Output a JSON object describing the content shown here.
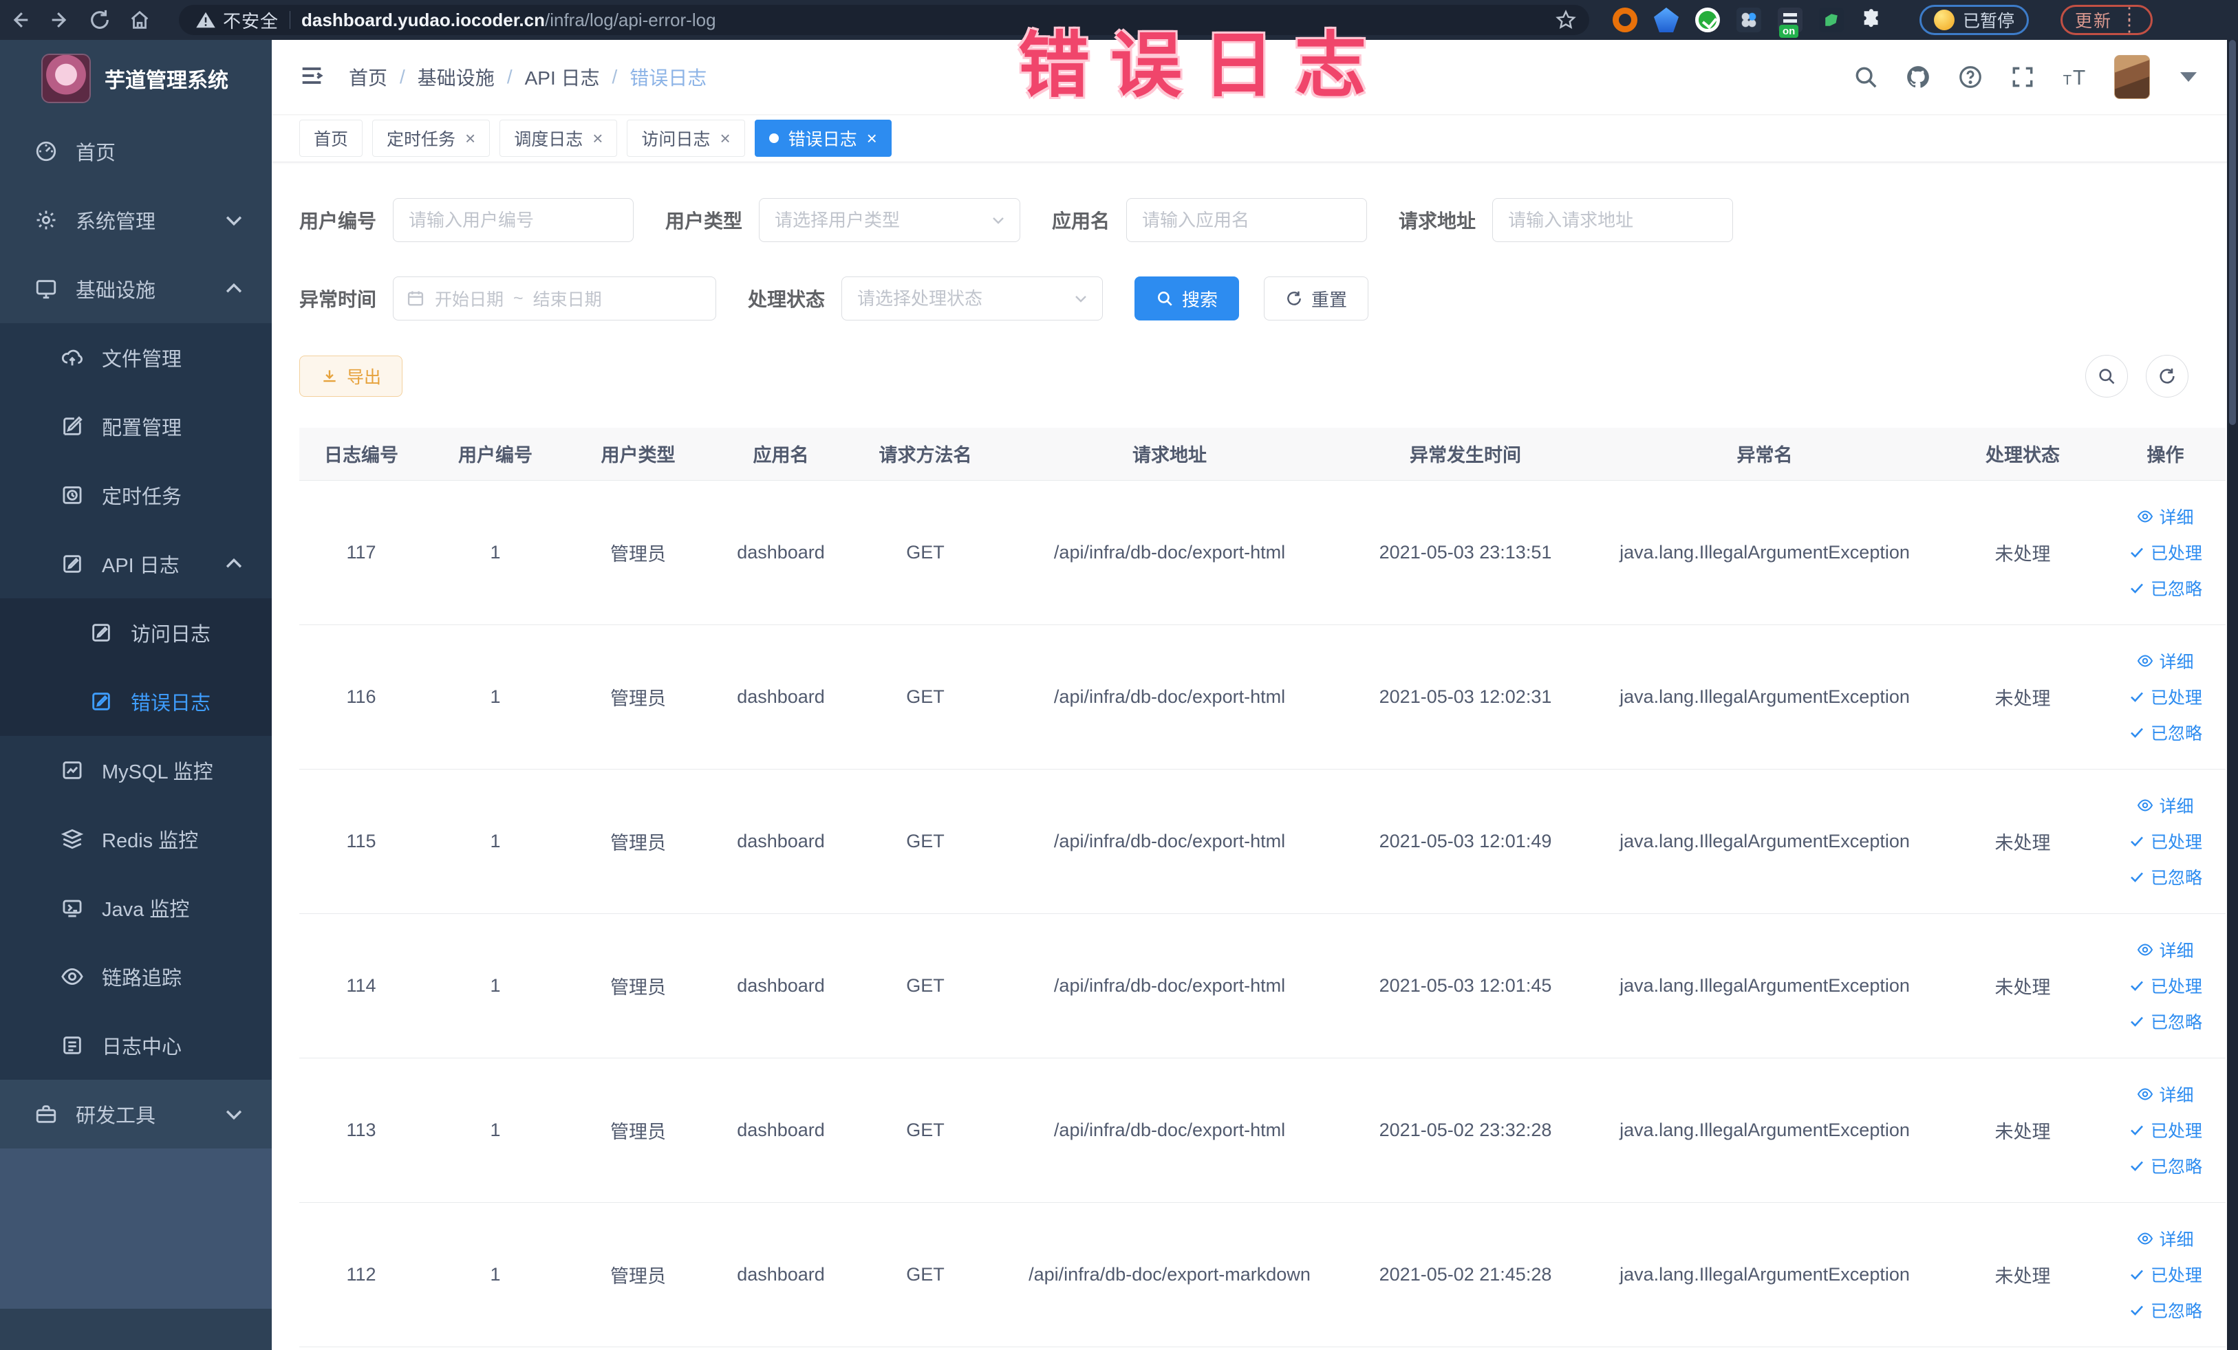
{
  "annotation": {
    "title": "错误日志"
  },
  "browser": {
    "security_label": "不安全",
    "url_domain": "dashboard.yudao.iocoder.cn",
    "url_path": "/infra/log/api-error-log",
    "paused_badge": "已暂停",
    "update_button": "更新"
  },
  "sidebar": {
    "logo_title": "芋道管理系统",
    "items": [
      {
        "label": "首页"
      },
      {
        "label": "系统管理"
      },
      {
        "label": "基础设施"
      },
      {
        "label": "文件管理"
      },
      {
        "label": "配置管理"
      },
      {
        "label": "定时任务"
      },
      {
        "label": "API 日志"
      },
      {
        "label": "访问日志"
      },
      {
        "label": "错误日志"
      },
      {
        "label": "MySQL 监控"
      },
      {
        "label": "Redis 监控"
      },
      {
        "label": "Java 监控"
      },
      {
        "label": "链路追踪"
      },
      {
        "label": "日志中心"
      },
      {
        "label": "研发工具"
      }
    ]
  },
  "breadcrumb": {
    "items": [
      "首页",
      "基础设施",
      "API 日志",
      "错误日志"
    ]
  },
  "tabs": [
    {
      "label": "首页"
    },
    {
      "label": "定时任务"
    },
    {
      "label": "调度日志"
    },
    {
      "label": "访问日志"
    },
    {
      "label": "错误日志"
    }
  ],
  "filters": {
    "user_id_label": "用户编号",
    "user_id_placeholder": "请输入用户编号",
    "user_type_label": "用户类型",
    "user_type_placeholder": "请选择用户类型",
    "app_name_label": "应用名",
    "app_name_placeholder": "请输入应用名",
    "request_url_label": "请求地址",
    "request_url_placeholder": "请输入请求地址",
    "exception_time_label": "异常时间",
    "start_date_placeholder": "开始日期",
    "range_separator": "~",
    "end_date_placeholder": "结束日期",
    "process_status_label": "处理状态",
    "process_status_placeholder": "请选择处理状态",
    "search_button": "搜索",
    "reset_button": "重置"
  },
  "toolbar": {
    "export_button": "导出"
  },
  "table": {
    "columns": [
      "日志编号",
      "用户编号",
      "用户类型",
      "应用名",
      "请求方法名",
      "请求地址",
      "异常发生时间",
      "异常名",
      "处理状态",
      "操作"
    ],
    "row_actions": [
      {
        "label": "详细"
      },
      {
        "label": "已处理"
      },
      {
        "label": "已忽略"
      }
    ],
    "rows": [
      {
        "id": "117",
        "user_id": "1",
        "user_type": "管理员",
        "app": "dashboard",
        "method": "GET",
        "url": "/api/infra/db-doc/export-html",
        "time": "2021-05-03 23:13:51",
        "exception": "java.lang.IllegalArgumentException",
        "status": "未处理"
      },
      {
        "id": "116",
        "user_id": "1",
        "user_type": "管理员",
        "app": "dashboard",
        "method": "GET",
        "url": "/api/infra/db-doc/export-html",
        "time": "2021-05-03 12:02:31",
        "exception": "java.lang.IllegalArgumentException",
        "status": "未处理"
      },
      {
        "id": "115",
        "user_id": "1",
        "user_type": "管理员",
        "app": "dashboard",
        "method": "GET",
        "url": "/api/infra/db-doc/export-html",
        "time": "2021-05-03 12:01:49",
        "exception": "java.lang.IllegalArgumentException",
        "status": "未处理"
      },
      {
        "id": "114",
        "user_id": "1",
        "user_type": "管理员",
        "app": "dashboard",
        "method": "GET",
        "url": "/api/infra/db-doc/export-html",
        "time": "2021-05-03 12:01:45",
        "exception": "java.lang.IllegalArgumentException",
        "status": "未处理"
      },
      {
        "id": "113",
        "user_id": "1",
        "user_type": "管理员",
        "app": "dashboard",
        "method": "GET",
        "url": "/api/infra/db-doc/export-html",
        "time": "2021-05-02 23:32:28",
        "exception": "java.lang.IllegalArgumentException",
        "status": "未处理"
      },
      {
        "id": "112",
        "user_id": "1",
        "user_type": "管理员",
        "app": "dashboard",
        "method": "GET",
        "url": "/api/infra/db-doc/export-markdown",
        "time": "2021-05-02 21:45:28",
        "exception": "java.lang.IllegalArgumentException",
        "status": "未处理"
      }
    ]
  },
  "colors": {
    "accent": "#2d8cf0",
    "sidebar": "#2e4156",
    "active_menu": "#3f9eff",
    "annotation": "#f0456b",
    "warning": "#e6a23c"
  }
}
